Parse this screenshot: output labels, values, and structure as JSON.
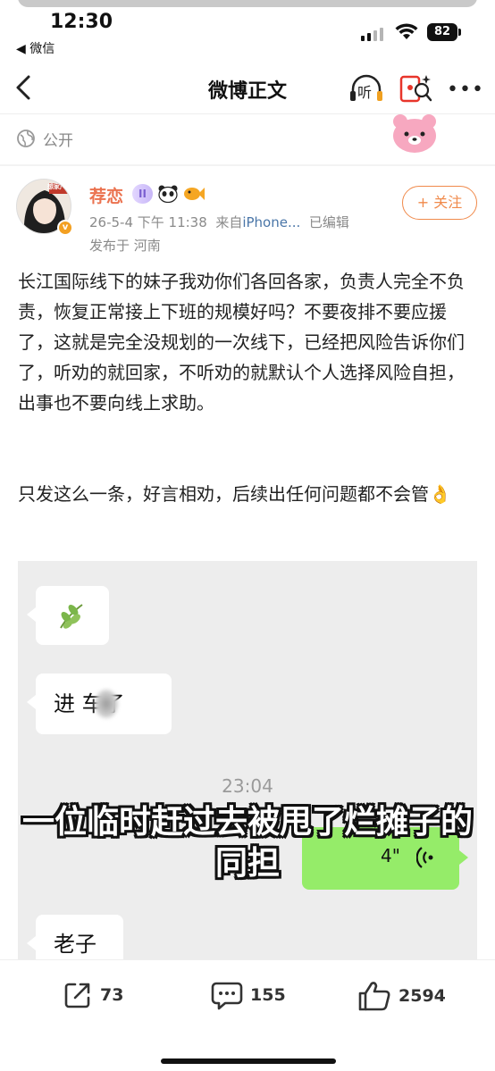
{
  "status_bar": {
    "time": "12:30",
    "back_app": "◀ 微信",
    "battery": "82"
  },
  "nav": {
    "title": "微博正文",
    "listen_label": "听",
    "icons": [
      "back-arrow-icon",
      "listen-headphones-icon",
      "red-packet-icon",
      "more-icon"
    ]
  },
  "visibility": {
    "label": "公开"
  },
  "post": {
    "author": "荐恋",
    "avatar_label": "想家产",
    "level_badge": "II",
    "meta_time": "26-5-4 下午 11:38",
    "meta_from": "来自",
    "meta_source": "iPhone...",
    "meta_edited": "已编辑",
    "location": "发布于 河南",
    "follow_label": "+ 关注",
    "body": "长江国际线下的妹子我劝你们各回各家，负责人完全不负责，恢复正常接上下班的规模好吗？不要夜排不要应援了，这就是完全没规划的一次线下，已经把风险告诉你们了，听劝的就回家，不听劝的就默认个人选择风险自担，出事也不要向线上求助。",
    "body2": "只发这么一条，好言相劝，后续出任何问题都不会管👌"
  },
  "chat_image": {
    "bubble2_text": "进 车了",
    "timestamp": "23:04",
    "voice_duration": "4\"",
    "caption": "一位临时赶过去被甩了烂摊子的同担",
    "bubble3_text": "老子"
  },
  "actions": {
    "repost_count": "73",
    "comment_count": "155",
    "like_count": "2594"
  },
  "colors": {
    "accent_orange": "#eb7350",
    "follow_orange": "#f08a4b",
    "wechat_green": "#95ec69",
    "chat_bg": "#ededed"
  }
}
